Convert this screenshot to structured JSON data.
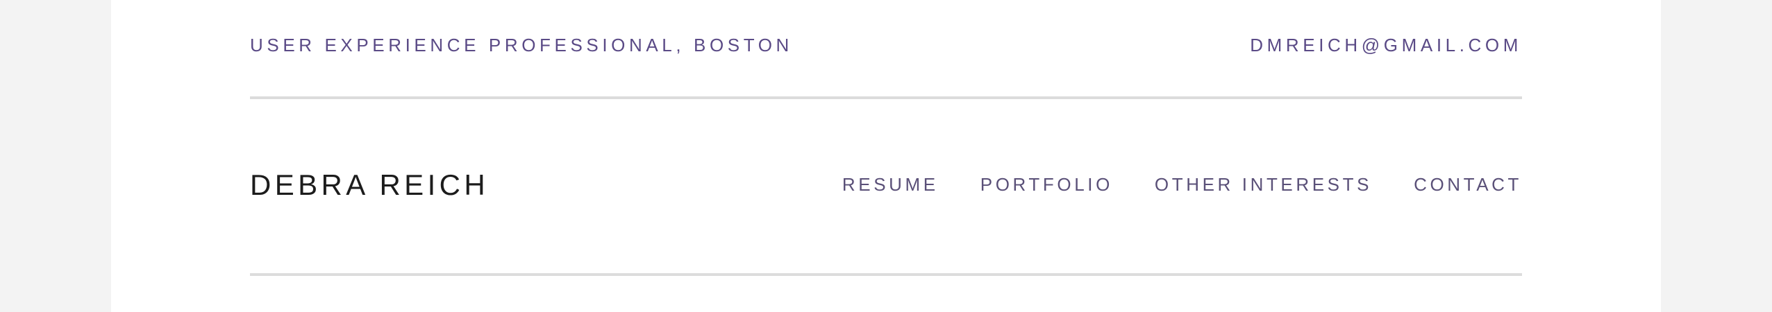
{
  "header": {
    "tagline": "USER EXPERIENCE PROFESSIONAL, BOSTON",
    "email": "DMREICH@GMAIL.COM"
  },
  "site": {
    "title": "DEBRA REICH"
  },
  "nav": {
    "items": [
      {
        "label": "RESUME"
      },
      {
        "label": "PORTFOLIO"
      },
      {
        "label": "OTHER INTERESTS"
      },
      {
        "label": "CONTACT"
      }
    ]
  },
  "colors": {
    "accent": "#5a4a86",
    "nav_text": "#5a5078",
    "title_text": "#1c1c1c",
    "rule": "#dcdcdc",
    "page_bg": "#ffffff",
    "outer_bg": "#f3f3f3"
  }
}
